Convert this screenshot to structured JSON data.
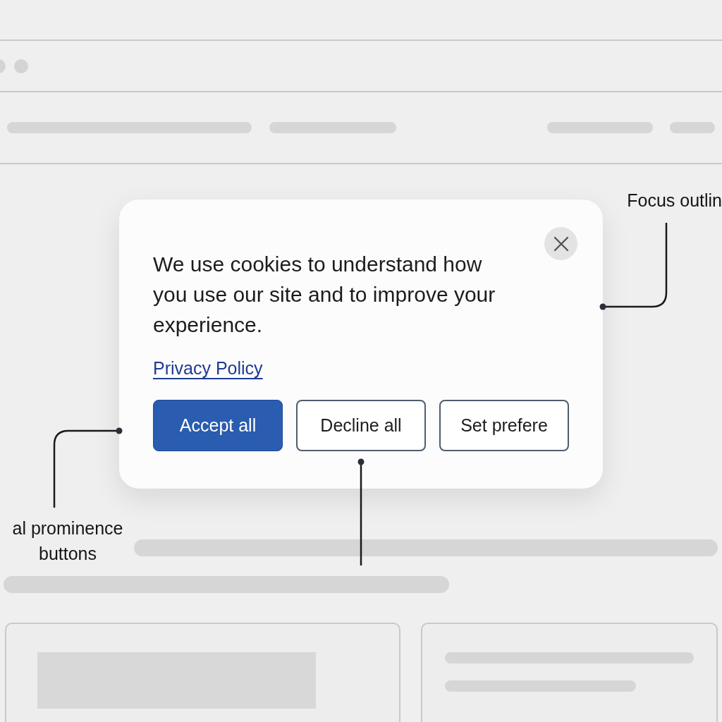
{
  "dialog": {
    "message": "We use cookies to understand how you use our site and to improve your experience.",
    "link": "Privacy Policy",
    "buttons": [
      {
        "label": "Accept all",
        "kind": "primary"
      },
      {
        "label": "Decline all",
        "kind": "secondary"
      },
      {
        "label": "Set prefere",
        "kind": "secondary"
      }
    ]
  },
  "annotations": [
    {
      "text": "Focus outlin"
    },
    {
      "text": "al prominence buttons"
    }
  ]
}
